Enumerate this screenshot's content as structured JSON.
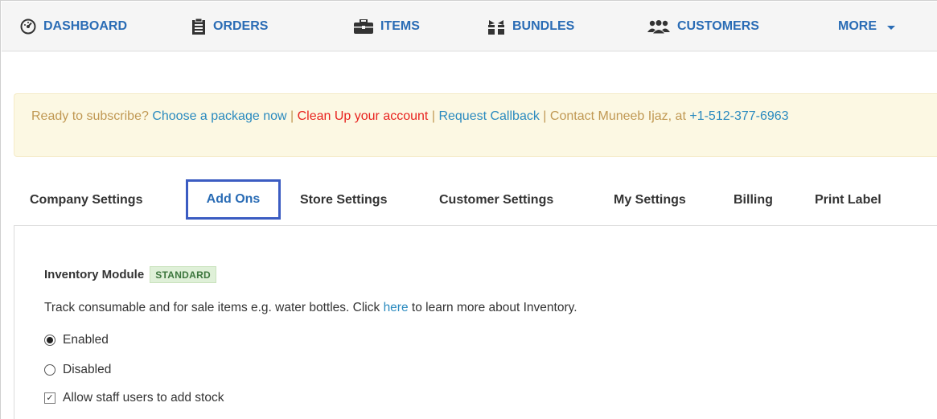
{
  "nav": {
    "items": [
      {
        "label": "DASHBOARD",
        "icon": "dashboard-gauge-icon"
      },
      {
        "label": "ORDERS",
        "icon": "clipboard-icon"
      },
      {
        "label": "ITEMS",
        "icon": "briefcase-icon"
      },
      {
        "label": "BUNDLES",
        "icon": "gift-icon"
      },
      {
        "label": "CUSTOMERS",
        "icon": "users-icon"
      }
    ],
    "more_label": "MORE",
    "color": "#2a6cb5"
  },
  "alert": {
    "prefix": "Ready to subscribe?",
    "choose_package": "Choose a package now",
    "separator": "|",
    "clean_up": "Clean Up your account",
    "request_callback": "Request Callback",
    "contact_text": "Contact Muneeb Ijaz, at",
    "phone": "+1-512-377-6963",
    "background": "#fcf8e3"
  },
  "tabs": {
    "company": "Company Settings",
    "addons": "Add Ons",
    "store": "Store Settings",
    "customer": "Customer Settings",
    "my": "My Settings",
    "billing": "Billing",
    "print": "Print Label",
    "active": "Add Ons"
  },
  "module": {
    "title": "Inventory Module",
    "badge": "STANDARD",
    "description_before": "Track consumable and for sale items e.g. water bottles. Click",
    "description_link": "here",
    "description_after": "to learn more about Inventory.",
    "options": {
      "enabled": "Enabled",
      "disabled": "Disabled",
      "selected": "Enabled"
    },
    "staff_stock_label": "Allow staff users to add stock",
    "staff_stock_checked": true
  }
}
